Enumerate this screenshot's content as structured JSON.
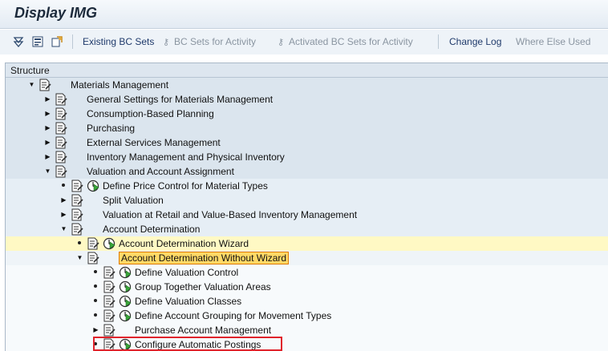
{
  "window": {
    "title": "Display IMG"
  },
  "toolbar": {
    "icons": [
      "expand-subtree-icon",
      "info-icon",
      "documentation-icon"
    ],
    "buttons": [
      {
        "label": "Existing BC Sets",
        "enabled": true,
        "icon": ""
      },
      {
        "label": "BC Sets for Activity",
        "enabled": false,
        "icon": "⚷"
      },
      {
        "label": "Activated BC Sets for Activity",
        "enabled": false,
        "icon": "⚷"
      },
      {
        "label": "Change Log",
        "enabled": true,
        "icon": ""
      },
      {
        "label": "Where Else Used",
        "enabled": false,
        "icon": ""
      }
    ]
  },
  "tree": {
    "header": "Structure",
    "nodes": [
      {
        "label": "Materials Management",
        "level": 0,
        "state": "expanded",
        "exec": false
      },
      {
        "label": "General Settings for Materials Management",
        "level": 1,
        "state": "collapsed",
        "exec": false
      },
      {
        "label": "Consumption-Based Planning",
        "level": 1,
        "state": "collapsed",
        "exec": false
      },
      {
        "label": "Purchasing",
        "level": 1,
        "state": "collapsed",
        "exec": false
      },
      {
        "label": "External Services Management",
        "level": 1,
        "state": "collapsed",
        "exec": false
      },
      {
        "label": "Inventory Management and Physical Inventory",
        "level": 1,
        "state": "collapsed",
        "exec": false
      },
      {
        "label": "Valuation and Account Assignment",
        "level": 1,
        "state": "expanded",
        "exec": false
      },
      {
        "label": "Define Price Control for Material Types",
        "level": 2,
        "state": "leaf",
        "exec": true
      },
      {
        "label": "Split Valuation",
        "level": 2,
        "state": "collapsed",
        "exec": false
      },
      {
        "label": "Valuation at Retail and Value-Based Inventory Management",
        "level": 2,
        "state": "collapsed",
        "exec": false
      },
      {
        "label": "Account Determination",
        "level": 2,
        "state": "expanded",
        "exec": false
      },
      {
        "label": "Account Determination Wizard",
        "level": 3,
        "state": "leaf",
        "exec": true,
        "selected": true
      },
      {
        "label": "Account Determination Without Wizard",
        "level": 3,
        "state": "expanded",
        "exec": false,
        "boxed": true
      },
      {
        "label": "Define Valuation Control",
        "level": 4,
        "state": "leaf",
        "exec": true
      },
      {
        "label": "Group Together Valuation Areas",
        "level": 4,
        "state": "leaf",
        "exec": true
      },
      {
        "label": "Define Valuation Classes",
        "level": 4,
        "state": "leaf",
        "exec": true
      },
      {
        "label": "Define Account Grouping for Movement Types",
        "level": 4,
        "state": "leaf",
        "exec": true
      },
      {
        "label": "Purchase Account Management",
        "level": 4,
        "state": "collapsed",
        "exec": false
      },
      {
        "label": "Configure Automatic Postings",
        "level": 4,
        "state": "leaf",
        "exec": true,
        "highlighted": true
      }
    ]
  },
  "colors": {
    "highlight_border": "#e0232b",
    "selected_row": "#fff9c4",
    "focus_box": "#ffd966"
  }
}
